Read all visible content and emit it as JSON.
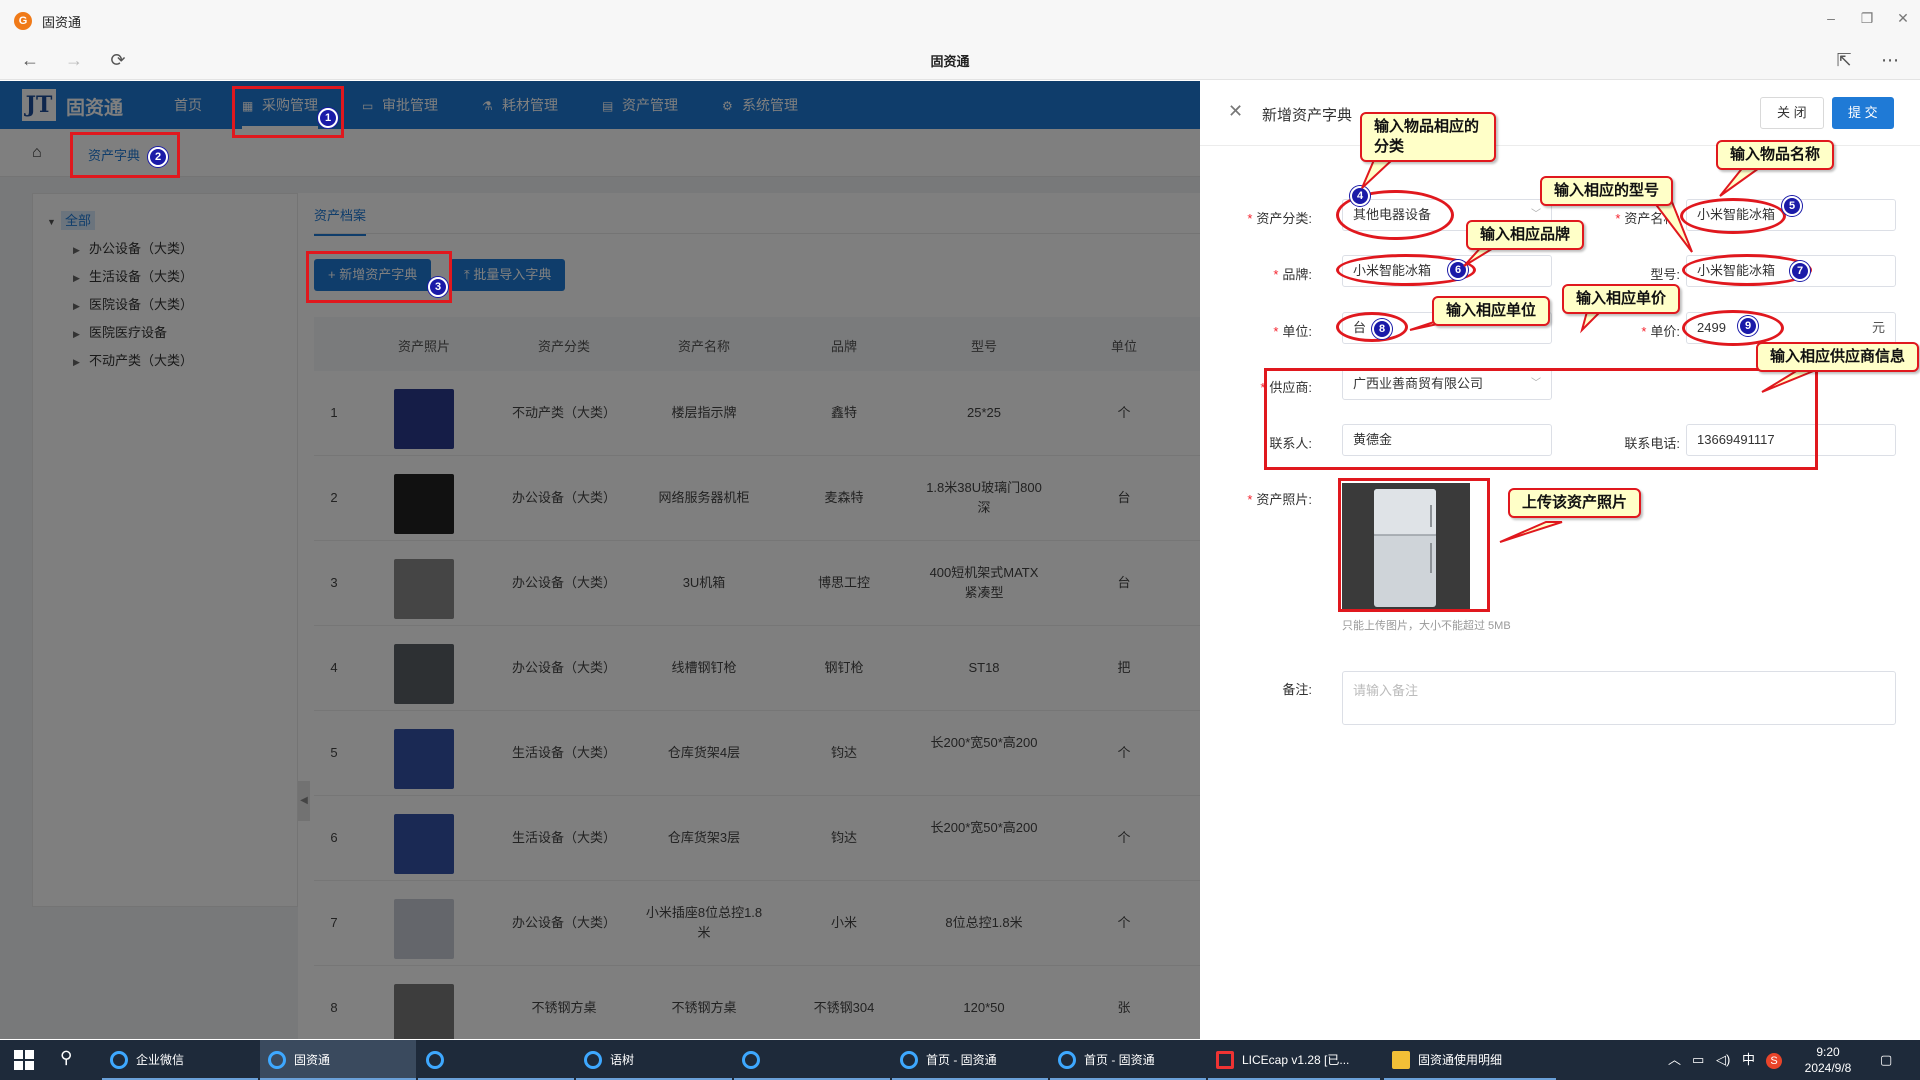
{
  "window": {
    "title": "固资通",
    "page_title": "固资通",
    "min": "–",
    "restore": "❐",
    "close": "✕",
    "logo_letter": "G"
  },
  "nav": {
    "back": "←",
    "forward": "→",
    "reload": "⟳",
    "share": "⇱",
    "more": "⋯"
  },
  "app": {
    "brand_logo": "JT",
    "brand_name": "固资通",
    "menu": [
      {
        "label": "首页",
        "icon": ""
      },
      {
        "label": "采购管理",
        "icon": "▦"
      },
      {
        "label": "审批管理",
        "icon": "▭"
      },
      {
        "label": "耗材管理",
        "icon": "⚗"
      },
      {
        "label": "资产管理",
        "icon": "▤"
      },
      {
        "label": "系统管理",
        "icon": "⚙"
      }
    ],
    "breadcrumb": "资产字典",
    "home_icon": "⌂",
    "tree": {
      "root": "全部",
      "items": [
        "办公设备（大类）",
        "生活设备（大类）",
        "医院设备（大类）",
        "医院医疗设备",
        "不动产类（大类）"
      ]
    },
    "tab": "资产档案",
    "buttons": {
      "add": "+ 新增资产字典",
      "import": "⤒ 批量导入字典"
    },
    "table": {
      "headers": [
        "资产照片",
        "资产分类",
        "资产名称",
        "品牌",
        "型号",
        "单位"
      ],
      "rows": [
        {
          "no": "1",
          "category": "不动产类（大类）",
          "name": "楼层指示牌",
          "brand": "鑫特",
          "model": "25*25",
          "unit": "个"
        },
        {
          "no": "2",
          "category": "办公设备（大类）",
          "name": "网络服务器机柜",
          "brand": "麦森特",
          "model": "1.8米38U玻璃门800深",
          "unit": "台"
        },
        {
          "no": "3",
          "category": "办公设备（大类）",
          "name": "3U机箱",
          "brand": "博思工控",
          "model": "400短机架式MATX紧凑型",
          "unit": "台"
        },
        {
          "no": "4",
          "category": "办公设备（大类）",
          "name": "线槽钢钉枪",
          "brand": "钢钉枪",
          "model": "ST18",
          "unit": "把"
        },
        {
          "no": "5",
          "category": "生活设备（大类）",
          "name": "仓库货架4层",
          "brand": "钧达",
          "model": "长200*宽50*高200",
          "unit": "个"
        },
        {
          "no": "6",
          "category": "生活设备（大类）",
          "name": "仓库货架3层",
          "brand": "钧达",
          "model": "长200*宽50*高200",
          "unit": "个"
        },
        {
          "no": "7",
          "category": "办公设备（大类）",
          "name": "小米插座8位总控1.8米",
          "brand": "小米",
          "model": "8位总控1.8米",
          "unit": "个"
        },
        {
          "no": "8",
          "category": "不锈钢方桌",
          "name": "不锈钢方桌",
          "brand": "不锈钢304",
          "model": "120*50",
          "unit": "张"
        }
      ]
    }
  },
  "drawer": {
    "title": "新增资产字典",
    "close_label": "关 闭",
    "submit_label": "提 交",
    "fields": {
      "category": {
        "label": "资产分类:",
        "value": "其他电器设备"
      },
      "name": {
        "label": "资产名称:",
        "value": "小米智能冰箱"
      },
      "brand": {
        "label": "品牌:",
        "value": "小米智能冰箱"
      },
      "model": {
        "label": "型号:",
        "value": "小米智能冰箱"
      },
      "unit": {
        "label": "单位:",
        "value": "台"
      },
      "price": {
        "label": "单价:",
        "value": "2499",
        "suffix": "元"
      },
      "supplier": {
        "label": "供应商:",
        "value": "广西业善商贸有限公司"
      },
      "contact": {
        "label": "联系人:",
        "value": "黄德金"
      },
      "phone": {
        "label": "联系电话:",
        "value": "13669491117"
      },
      "photo": {
        "label": "资产照片:",
        "tip": "只能上传图片，大小不能超过 5MB"
      },
      "remark": {
        "label": "备注:",
        "placeholder": "请输入备注"
      }
    }
  },
  "annotations": {
    "callouts": [
      "输入物品相应的分类",
      "输入物品名称",
      "输入相应的型号",
      "输入相应品牌",
      "输入相应单位",
      "输入相应单价",
      "输入相应供应商信息",
      "上传该资产照片"
    ],
    "badges": [
      "1",
      "2",
      "3",
      "4",
      "5",
      "6",
      "7",
      "8",
      "9"
    ],
    "color": "#e0181e"
  },
  "taskbar": {
    "items": [
      "企业微信",
      "固资通",
      "",
      "语树",
      "",
      "首页 - 固资通",
      "首页 - 固资通",
      "LICEcap v1.28 [已...",
      "固资通使用明细"
    ],
    "tray": {
      "ime": "中",
      "time": "9:20",
      "date": "2024/9/8"
    }
  },
  "colors": {
    "brand": "#1f7ad6",
    "annotation": "#e0181e",
    "badge": "#1a1aa8",
    "callout_bg": "#ffffc8"
  }
}
